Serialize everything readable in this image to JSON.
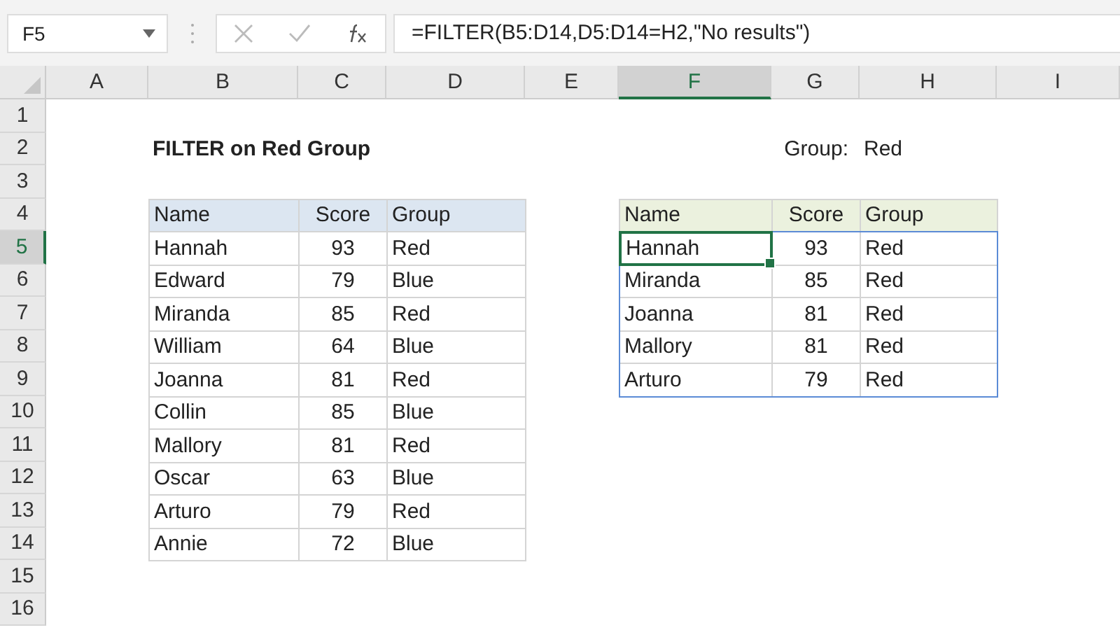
{
  "name_box": {
    "value": "F5"
  },
  "formula_bar": {
    "formula": "=FILTER(B5:D14,D5:D14=H2,\"No results\")"
  },
  "columns": [
    {
      "label": "A",
      "selected": false
    },
    {
      "label": "B",
      "selected": false
    },
    {
      "label": "C",
      "selected": false
    },
    {
      "label": "D",
      "selected": false
    },
    {
      "label": "E",
      "selected": false
    },
    {
      "label": "F",
      "selected": true
    },
    {
      "label": "G",
      "selected": false
    },
    {
      "label": "H",
      "selected": false
    },
    {
      "label": "I",
      "selected": false
    }
  ],
  "rows": [
    {
      "label": "1",
      "selected": false
    },
    {
      "label": "2",
      "selected": false
    },
    {
      "label": "3",
      "selected": false
    },
    {
      "label": "4",
      "selected": false
    },
    {
      "label": "5",
      "selected": true
    },
    {
      "label": "6",
      "selected": false
    },
    {
      "label": "7",
      "selected": false
    },
    {
      "label": "8",
      "selected": false
    },
    {
      "label": "9",
      "selected": false
    },
    {
      "label": "10",
      "selected": false
    },
    {
      "label": "11",
      "selected": false
    },
    {
      "label": "12",
      "selected": false
    },
    {
      "label": "13",
      "selected": false
    },
    {
      "label": "14",
      "selected": false
    },
    {
      "label": "15",
      "selected": false
    },
    {
      "label": "16",
      "selected": false
    }
  ],
  "title": "FILTER on Red Group",
  "criteria": {
    "label": "Group:",
    "value": "Red"
  },
  "source_table": {
    "columns": [
      "Name",
      "Score",
      "Group"
    ],
    "rows": [
      {
        "cells": [
          "Hannah",
          "93",
          "Red"
        ]
      },
      {
        "cells": [
          "Edward",
          "79",
          "Blue"
        ]
      },
      {
        "cells": [
          "Miranda",
          "85",
          "Red"
        ]
      },
      {
        "cells": [
          "William",
          "64",
          "Blue"
        ]
      },
      {
        "cells": [
          "Joanna",
          "81",
          "Red"
        ]
      },
      {
        "cells": [
          "Collin",
          "85",
          "Blue"
        ]
      },
      {
        "cells": [
          "Mallory",
          "81",
          "Red"
        ]
      },
      {
        "cells": [
          "Oscar",
          "63",
          "Blue"
        ]
      },
      {
        "cells": [
          "Arturo",
          "79",
          "Red"
        ]
      },
      {
        "cells": [
          "Annie",
          "72",
          "Blue"
        ]
      }
    ]
  },
  "result_table": {
    "columns": [
      "Name",
      "Score",
      "Group"
    ],
    "rows": [
      {
        "cells": [
          "Hannah",
          "93",
          "Red"
        ],
        "selected": true
      },
      {
        "cells": [
          "Miranda",
          "85",
          "Red"
        ],
        "selected": false
      },
      {
        "cells": [
          "Joanna",
          "81",
          "Red"
        ],
        "selected": false
      },
      {
        "cells": [
          "Mallory",
          "81",
          "Red"
        ],
        "selected": false
      },
      {
        "cells": [
          "Arturo",
          "79",
          "Red"
        ],
        "selected": false
      }
    ]
  }
}
